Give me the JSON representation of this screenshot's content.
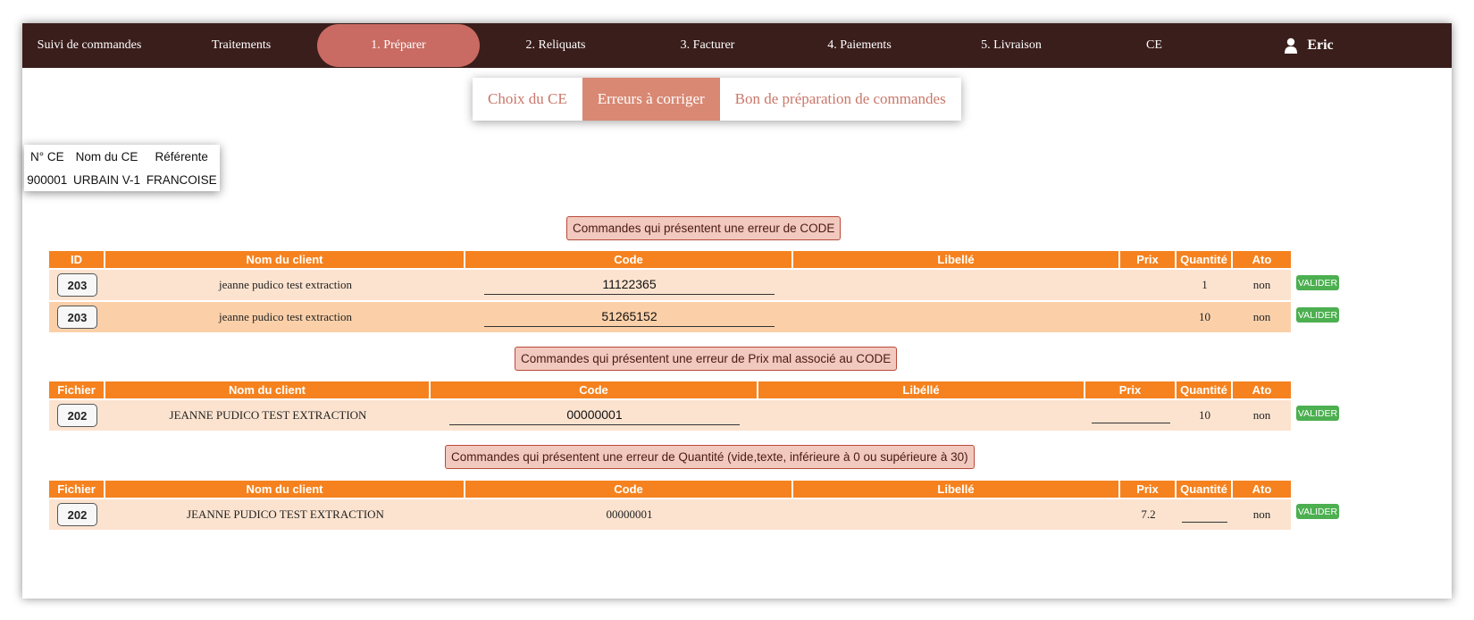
{
  "nav": {
    "items": [
      "Suivi de commandes",
      "Traitements",
      "1. Préparer",
      "2. Reliquats",
      "3. Facturer",
      "4. Paiements",
      "5. Livraison",
      "CE"
    ],
    "active_index": 2,
    "user": "Eric"
  },
  "subtabs": [
    "Choix du CE",
    "Erreurs à corriger",
    "Bon de préparation de commandes"
  ],
  "subtab_active": 1,
  "ce": {
    "headers": [
      "N° CE",
      "Nom du CE",
      "Référente"
    ],
    "values": [
      "900001",
      "URBAIN V-1",
      "FRANCOISE"
    ]
  },
  "section1": {
    "title": "Commandes qui présentent une erreur de CODE",
    "headers": [
      "ID",
      "Nom du client",
      "Code",
      "Libellé",
      "Prix",
      "Quantité",
      "Ato"
    ],
    "rows": [
      {
        "id": "203",
        "client": "jeanne pudico test extraction",
        "code": "11122365",
        "libelle": "",
        "prix": "",
        "quantite": "1",
        "ato": "non"
      },
      {
        "id": "203",
        "client": "jeanne pudico test extraction",
        "code": "51265152",
        "libelle": "",
        "prix": "",
        "quantite": "10",
        "ato": "non"
      }
    ]
  },
  "section2": {
    "title": "Commandes qui présentent une erreur de Prix mal associé au CODE",
    "headers": [
      "Fichier",
      "Nom du client",
      "Code",
      "Libéllé",
      "Prix",
      "Quantité",
      "Ato"
    ],
    "rows": [
      {
        "id": "202",
        "client": "JEANNE PUDICO TEST EXTRACTION",
        "code": "00000001",
        "libelle": "",
        "prix": "",
        "quantite": "10",
        "ato": "non"
      }
    ]
  },
  "section3": {
    "title": "Commandes qui présentent une erreur de Quantité (vide,texte, inférieure à 0 ou supérieure à 30)",
    "headers": [
      "Fichier",
      "Nom du client",
      "Code",
      "Libellé",
      "Prix",
      "Quantité",
      "Ato"
    ],
    "rows": [
      {
        "id": "202",
        "client": "JEANNE PUDICO TEST EXTRACTION",
        "code": "00000001",
        "libelle": "",
        "prix": "7.2",
        "quantite": "",
        "ato": "non"
      }
    ]
  },
  "valider_label": "VALIDER",
  "colors": {
    "nav_bg": "#3a1e1c",
    "nav_active": "#c96b62",
    "table_header": "#f5821f",
    "valider": "#4caf50"
  }
}
